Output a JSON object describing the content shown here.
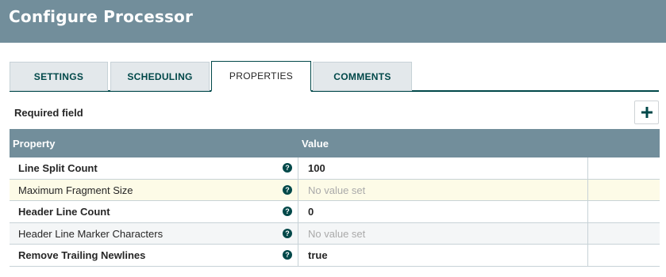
{
  "dialog": {
    "title": "Configure Processor"
  },
  "tabs": [
    {
      "label": "SETTINGS"
    },
    {
      "label": "SCHEDULING"
    },
    {
      "label": "PROPERTIES"
    },
    {
      "label": "COMMENTS"
    }
  ],
  "active_tab": "PROPERTIES",
  "required_label": "Required field",
  "add_button": {
    "icon": "plus-icon"
  },
  "table": {
    "headers": {
      "property": "Property",
      "value": "Value"
    },
    "rows": [
      {
        "property": "Line Split Count",
        "value": "100"
      },
      {
        "property": "Maximum Fragment Size",
        "value": "No value set"
      },
      {
        "property": "Header Line Count",
        "value": "0"
      },
      {
        "property": "Header Line Marker Characters",
        "value": "No value set"
      },
      {
        "property": "Remove Trailing Newlines",
        "value": "true"
      }
    ]
  },
  "colors": {
    "header_bg": "#728e9b",
    "accent": "#004849",
    "highlight_row": "#fdfbe7",
    "help_icon": "#004849"
  }
}
